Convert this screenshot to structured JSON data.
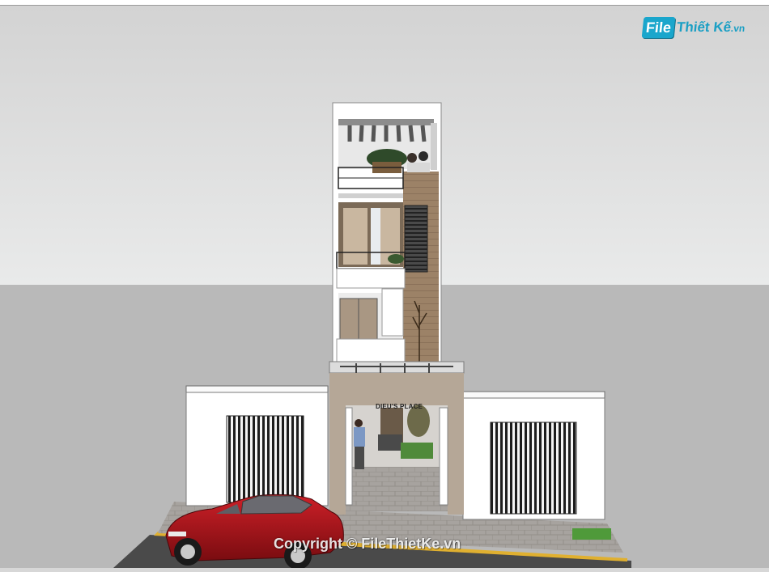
{
  "logo": {
    "file": "File",
    "brand": "Thiết Kế",
    "tld": ".vn"
  },
  "building_sign": "DIEU'S PLACE",
  "watermark": "Copyright © FileThietKe.vn",
  "colors": {
    "sky": "#d7d7d7",
    "ground": "#b9b9b9",
    "wall": "#ffffff",
    "wood": "#9c8267",
    "car": "#b3141b",
    "logo_blue": "#1aa6cc"
  }
}
